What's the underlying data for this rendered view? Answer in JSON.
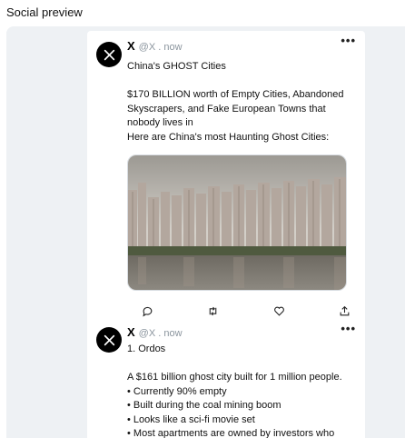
{
  "page": {
    "title": "Social preview"
  },
  "tweets": [
    {
      "author": "X",
      "handle": "@X . now",
      "text": "China's GHOST Cities\n\n$170 BILLION worth of Empty Cities, Abandoned Skyscrapers, and Fake European Towns that nobody lives in\nHere are China's most Haunting Ghost Cities:",
      "more": "•••",
      "media_icon": "ghost-city-photo",
      "actions": [
        "reply-icon",
        "repost-icon",
        "like-icon",
        "share-icon"
      ]
    },
    {
      "author": "X",
      "handle": "@X . now",
      "text": "1. Ordos\n\nA $161 billion ghost city built for 1 million people.\n• Currently 90% empty\n• Built during the coal mining boom\n• Looks like a sci-fi movie set\n• Most apartments are owned by investors who",
      "more": "•••"
    }
  ],
  "colors": {
    "panel": "#eef1f4",
    "handle": "#8b959e",
    "avatar": "#000000"
  }
}
